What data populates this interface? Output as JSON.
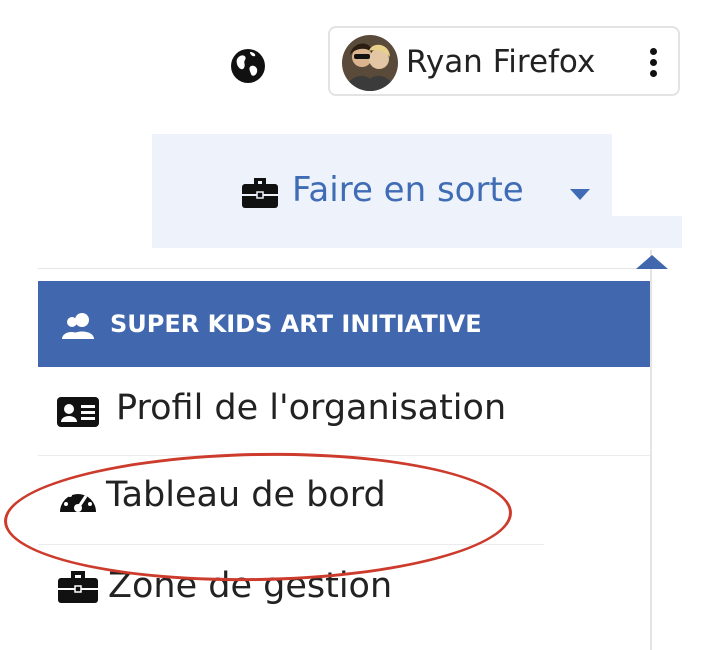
{
  "header": {
    "globe_icon": "globe-icon",
    "user_name": "Ryan Firefox",
    "menu_icon": "kebab-menu-icon"
  },
  "tab": {
    "icon": "briefcase-icon",
    "label": "Faire en sorte",
    "caret_icon": "caret-down-icon"
  },
  "dropdown": {
    "header": {
      "icon": "user-group-icon",
      "label": "SUPER KIDS ART INITIATIVE"
    },
    "items": [
      {
        "icon": "id-card-icon",
        "label": "Profil de l'organisation"
      },
      {
        "icon": "dashboard-gauge-icon",
        "label": "Tableau de bord"
      },
      {
        "icon": "briefcase-icon",
        "label": "Zone de gestion"
      }
    ]
  },
  "colors": {
    "accent": "#4168ae",
    "tab_background": "#edf2fb",
    "tab_text": "#3f6cb5",
    "highlight_annotation": "#cc3b2c"
  }
}
